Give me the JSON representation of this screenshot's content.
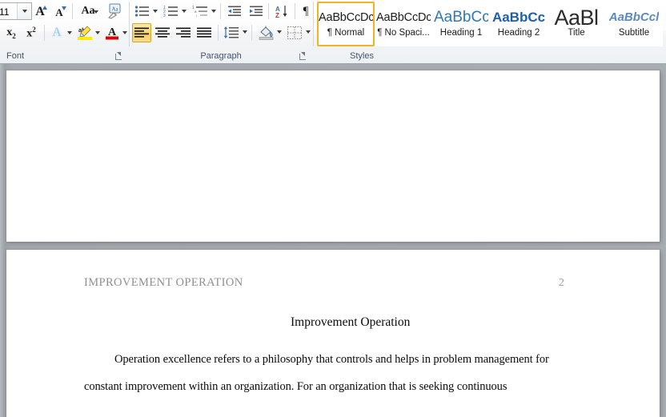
{
  "ribbon": {
    "groups": [
      {
        "id": "font",
        "label": "Font"
      },
      {
        "id": "paragraph",
        "label": "Paragraph"
      },
      {
        "id": "styles",
        "label": "Styles"
      }
    ],
    "font_group": {
      "label": "Font",
      "font_size_value": "11",
      "font_size_placeholder": "11",
      "buttons": [
        {
          "name": "grow-font-button",
          "label": "A",
          "icon": "grow-font-icon"
        },
        {
          "name": "shrink-font-button",
          "label": "A",
          "icon": "shrink-font-icon"
        },
        {
          "name": "change-case-button",
          "label": "Aa",
          "icon": "change-case-icon"
        },
        {
          "name": "clear-formatting-button",
          "label": "A",
          "icon": "clear-formatting-icon"
        },
        {
          "name": "subscript-button",
          "label": "x",
          "sub": "2",
          "icon": "subscript-icon"
        },
        {
          "name": "superscript-button",
          "label": "x",
          "sup": "2",
          "icon": "superscript-icon"
        },
        {
          "name": "text-effects-button",
          "label": "A",
          "icon": "text-effects-icon"
        },
        {
          "name": "text-highlight-color-button",
          "label": "ab",
          "icon": "highlight-icon"
        },
        {
          "name": "font-color-button",
          "label": "A",
          "icon": "font-color-icon"
        }
      ]
    },
    "paragraph_group": {
      "label": "Paragraph",
      "buttons": [
        {
          "name": "bullets-button",
          "icon": "bullet-list-icon"
        },
        {
          "name": "numbering-button",
          "icon": "numbered-list-icon"
        },
        {
          "name": "multilevel-list-button",
          "icon": "multilevel-list-icon"
        },
        {
          "name": "decrease-indent-button",
          "icon": "decrease-indent-icon"
        },
        {
          "name": "increase-indent-button",
          "icon": "increase-indent-icon"
        },
        {
          "name": "sort-button",
          "icon": "sort-az-icon"
        },
        {
          "name": "show-formatting-marks-button",
          "icon": "pilcrow-icon",
          "label": "¶"
        },
        {
          "name": "align-left-button",
          "icon": "align-left-icon",
          "selected": true
        },
        {
          "name": "align-center-button",
          "icon": "align-center-icon"
        },
        {
          "name": "align-right-button",
          "icon": "align-right-icon"
        },
        {
          "name": "justify-button",
          "icon": "justify-icon"
        },
        {
          "name": "line-spacing-button",
          "icon": "line-spacing-icon"
        },
        {
          "name": "shading-button",
          "icon": "shading-paint-bucket-icon"
        },
        {
          "name": "borders-button",
          "icon": "borders-icon"
        }
      ]
    },
    "styles_group": {
      "label": "Styles",
      "items": [
        {
          "preview": "AaBbCcDc",
          "name": "¶ Normal",
          "selected": true
        },
        {
          "preview": "AaBbCcDc",
          "name": "¶ No Spaci...",
          "selected": false
        },
        {
          "preview": "AaBbCс",
          "name": "Heading 1",
          "selected": false
        },
        {
          "preview": "AaBbCc",
          "name": "Heading 2",
          "selected": false
        },
        {
          "preview": "AaBl",
          "name": "Title",
          "selected": false
        },
        {
          "preview": "AaBbCcl",
          "name": "Subtitle",
          "selected": false
        }
      ]
    }
  },
  "document": {
    "page1": {},
    "page2": {
      "header_text": "IMPROVEMENT OPERATION",
      "page_number": "2",
      "title": "Improvement Operation",
      "body_lines": [
        "Operation excellence refers to a philosophy that controls and helps in problem management for",
        "constant improvement within an organization. For an organization that is seeking continuous"
      ]
    }
  },
  "colors": {
    "accent_selected": "#f0b323",
    "heading1": "#2f77b5",
    "heading2": "#1f5fa9",
    "subtitle": "#5b89c4",
    "group_label": "#44546a",
    "doc_background": "#a4a9af",
    "doc_header_gray": "#8d8f94"
  }
}
